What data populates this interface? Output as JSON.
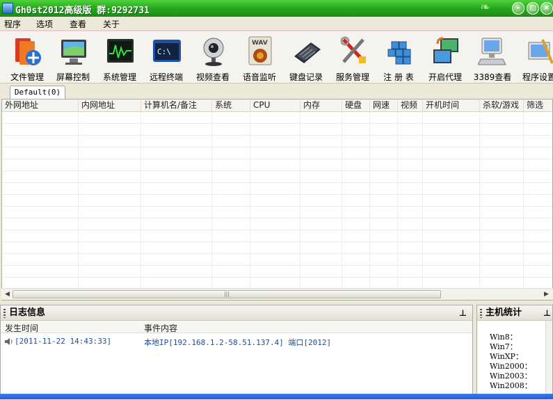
{
  "window": {
    "title": "Gh0st2012高级版 群:9292731",
    "buttons": [
      "minimize",
      "maximize",
      "close"
    ]
  },
  "menu": [
    "程序",
    "选项",
    "查看",
    "关于"
  ],
  "toolbar": [
    {
      "label": "文件管理",
      "icon": "file-manager-icon"
    },
    {
      "label": "屏幕控制",
      "icon": "screen-control-icon"
    },
    {
      "label": "系统管理",
      "icon": "system-manager-icon"
    },
    {
      "label": "远程终端",
      "icon": "remote-terminal-icon"
    },
    {
      "label": "视频查看",
      "icon": "webcam-icon"
    },
    {
      "label": "语音监听",
      "icon": "audio-wav-icon"
    },
    {
      "label": "键盘记录",
      "icon": "keyboard-icon"
    },
    {
      "label": "服务管理",
      "icon": "tools-icon"
    },
    {
      "label": "注 册 表",
      "icon": "registry-icon"
    },
    {
      "label": "开启代理",
      "icon": "proxy-icon"
    },
    {
      "label": "3389查看",
      "icon": "computer-icon"
    },
    {
      "label": "程序设置",
      "icon": "settings-icon"
    }
  ],
  "tabs": [
    {
      "label": "Default(0)"
    }
  ],
  "hosts_table": {
    "columns": [
      "外网地址",
      "内网地址",
      "计算机名/备注",
      "系统",
      "CPU",
      "内存",
      "硬盘",
      "网速",
      "视频",
      "开机时间",
      "杀软/游戏",
      "筛选"
    ],
    "rows": []
  },
  "log_panel": {
    "title": "日志信息",
    "columns": [
      "发生时间",
      "事件内容"
    ],
    "rows": [
      {
        "time": "[2011-11-22 14:43:33]",
        "event": "本地IP[192.168.1.2-58.51.137.4] 端口[2012]"
      }
    ]
  },
  "stats_panel": {
    "title": "主机统计",
    "items": [
      "Win8：",
      "Win7：",
      "WinXP：",
      "Win2000：",
      "Win2003：",
      "Win2008："
    ]
  },
  "colors": {
    "titlebar": "#26a51d",
    "log_text": "#1a4ea8",
    "menu_accent": "#f0c8e0"
  }
}
